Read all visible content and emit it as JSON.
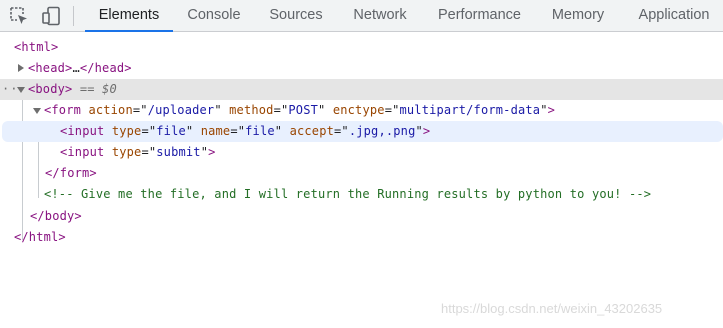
{
  "toolbar": {
    "icons": [
      "select-element-icon",
      "device-toggle-icon"
    ],
    "tabs": [
      {
        "label": "Elements",
        "active": true
      },
      {
        "label": "Console"
      },
      {
        "label": "Sources"
      },
      {
        "label": "Network"
      },
      {
        "label": "Performance"
      },
      {
        "label": "Memory"
      },
      {
        "label": "Application"
      }
    ]
  },
  "tree": {
    "html_open": "<html>",
    "head": {
      "open": "<head>",
      "ellipsis": "…",
      "close": "</head>"
    },
    "body": {
      "open": "<body>",
      "selected_marker": "== $0"
    },
    "form": {
      "tag": "form",
      "attrs": [
        {
          "name": "action",
          "value": "/uploader"
        },
        {
          "name": "method",
          "value": "POST"
        },
        {
          "name": "enctype",
          "value": "multipart/form-data"
        }
      ],
      "close": "</form>"
    },
    "input_file": {
      "tag": "input",
      "attrs": [
        {
          "name": "type",
          "value": "file"
        },
        {
          "name": "name",
          "value": "file"
        },
        {
          "name": "accept",
          "value": ".jpg,.png"
        }
      ]
    },
    "input_submit": {
      "tag": "input",
      "attrs": [
        {
          "name": "type",
          "value": "submit"
        }
      ]
    },
    "comment": "<!-- Give me the file, and I will return the Running results by python to you! -->",
    "body_close": "</body>",
    "html_close": "</html>"
  },
  "watermark": "https://blog.csdn.net/weixin_43202635",
  "colors": {
    "tag": "#881280",
    "attribute_name": "#994500",
    "attribute_value": "#1a1aa6",
    "comment": "#236e25",
    "active_tab_underline": "#1a73e8"
  }
}
